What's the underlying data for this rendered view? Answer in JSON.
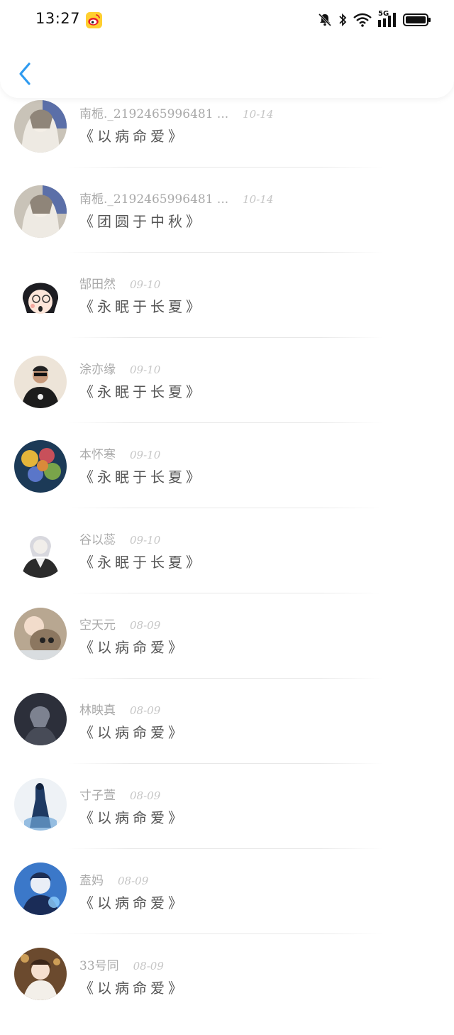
{
  "status_bar": {
    "time": "13:27",
    "network": "5G"
  },
  "items": [
    {
      "name": "南栀._2192465996481 ...",
      "date": "10-14",
      "title": "《以病命爱》"
    },
    {
      "name": "南栀._2192465996481 ...",
      "date": "10-14",
      "title": "《团圆于中秋》"
    },
    {
      "name": "郜田然",
      "date": "09-10",
      "title": "《永眠于长夏》"
    },
    {
      "name": "涂亦缘",
      "date": "09-10",
      "title": "《永眠于长夏》"
    },
    {
      "name": "本怀寒",
      "date": "09-10",
      "title": "《永眠于长夏》"
    },
    {
      "name": "谷以蕊",
      "date": "09-10",
      "title": "《永眠于长夏》"
    },
    {
      "name": "空天元",
      "date": "08-09",
      "title": "《以病命爱》"
    },
    {
      "name": "林映真",
      "date": "08-09",
      "title": "《以病命爱》"
    },
    {
      "name": "寸子萱",
      "date": "08-09",
      "title": "《以病命爱》"
    },
    {
      "name": "盍妈",
      "date": "08-09",
      "title": "《以病命爱》"
    },
    {
      "name": "33号同",
      "date": "08-09",
      "title": "《以病命爱》"
    }
  ],
  "colors": {
    "accent": "#2f9bf0",
    "name_text": "#a9a9a9",
    "date_text": "#c6c6c6",
    "title_text": "#555555"
  }
}
